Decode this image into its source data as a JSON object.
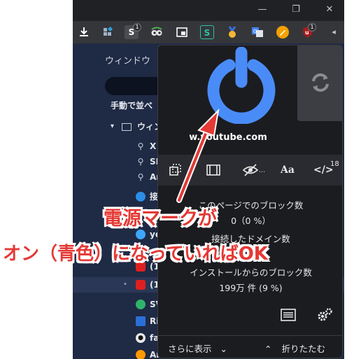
{
  "window": {
    "minimize": "—",
    "restore": "❐",
    "close": "✕"
  },
  "toolbar": {
    "icons": [
      "download-icon",
      "puzzle-icon",
      "extension-s-icon",
      "extension-eyes-icon",
      "extension-window-icon",
      "extension-bracket-s-icon",
      "extension-medal-icon",
      "extension-translate-icon",
      "extension-pencil-icon",
      "ublock-origin-icon"
    ],
    "badge_s": "1",
    "badge_ublock": "1",
    "more": "◂"
  },
  "side_panel": {
    "title": "ウィンドウ",
    "sort_label": "手動で並べ",
    "rows": [
      {
        "prefix": "▾",
        "text": "ウィン"
      },
      {
        "prefix": "",
        "text": "X"
      },
      {
        "prefix": "",
        "text": "SI"
      },
      {
        "prefix": "",
        "text": "Ar"
      },
      {
        "prefix": "",
        "text": "接"
      },
      {
        "prefix": "",
        "text": "yo"
      },
      {
        "prefix": "",
        "text": ""
      },
      {
        "prefix": "",
        "text": "(1"
      },
      {
        "prefix": "•",
        "text": "(1"
      },
      {
        "prefix": "",
        "text": "SV"
      },
      {
        "prefix": "",
        "text": "Ri"
      },
      {
        "prefix": "",
        "text": "fa"
      },
      {
        "prefix": "",
        "text": "Am"
      }
    ]
  },
  "popup": {
    "domain": "w.youtube.com",
    "tools": {
      "element_picker": "",
      "media": "",
      "cosmetic": "",
      "fonts": "Aa",
      "scripts": "</>",
      "scripts_count": "18"
    },
    "stats": {
      "page_blocks_label": "このページでのブロック数",
      "page_blocks_value": "0（0 %）",
      "domains_label": "接続したドメイン数",
      "domains_value": "",
      "install_blocks_label": "インストールからのブロック数",
      "install_blocks_value": "199万 件 (9 %)"
    },
    "footer": {
      "more": "さらに表示",
      "more_caret": "⌄",
      "less_caret": "⌃",
      "less": "折りたたむ"
    }
  },
  "annotation": {
    "line1": "電源マークが",
    "line2": "オン（青色）になっていればOK",
    "color": "#e53935"
  },
  "colors": {
    "power_on": "#4a8cf7",
    "popup_bg": "#1b1c20",
    "side_bg": "#1f2a44"
  }
}
